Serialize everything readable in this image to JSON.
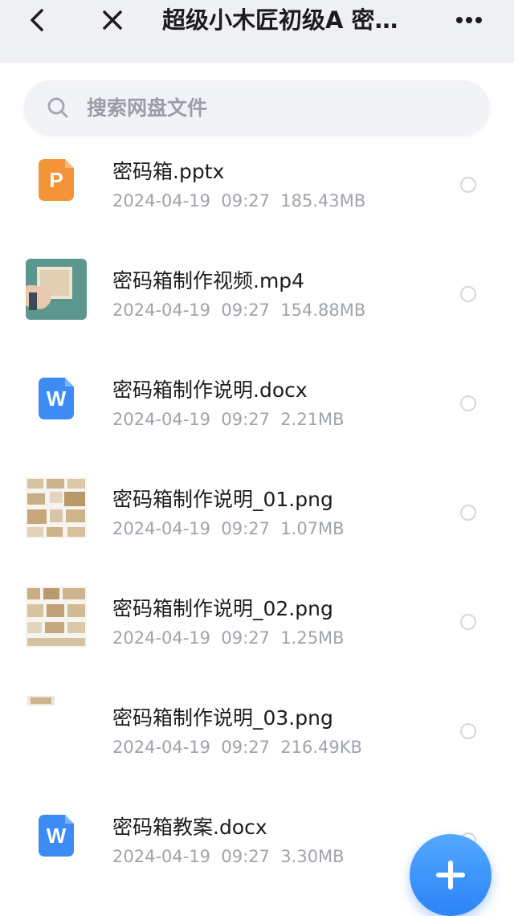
{
  "header": {
    "title": "超级小木匠初级A 密…",
    "back_icon": "chevron-left-icon",
    "close_icon": "close-icon",
    "more_icon": "more-horizontal-icon",
    "background": "#eef0f4"
  },
  "search": {
    "placeholder": "搜索网盘文件",
    "value": "",
    "icon": "search-icon"
  },
  "files": [
    {
      "name": "密码箱.pptx",
      "date": "2024-04-19",
      "time": "09:27",
      "size": "185.43MB",
      "type": "pptx",
      "icon": "ppt-file-icon",
      "color": "#f39438"
    },
    {
      "name": "密码箱制作视频.mp4",
      "date": "2024-04-19",
      "time": "09:27",
      "size": "154.88MB",
      "type": "mp4",
      "icon": "video-thumbnail"
    },
    {
      "name": "密码箱制作说明.docx",
      "date": "2024-04-19",
      "time": "09:27",
      "size": "2.21MB",
      "type": "docx",
      "icon": "word-file-icon",
      "color": "#3c8cf4"
    },
    {
      "name": "密码箱制作说明_01.png",
      "date": "2024-04-19",
      "time": "09:27",
      "size": "1.07MB",
      "type": "png",
      "icon": "image-thumbnail"
    },
    {
      "name": "密码箱制作说明_02.png",
      "date": "2024-04-19",
      "time": "09:27",
      "size": "1.25MB",
      "type": "png",
      "icon": "image-thumbnail"
    },
    {
      "name": "密码箱制作说明_03.png",
      "date": "2024-04-19",
      "time": "09:27",
      "size": "216.49KB",
      "type": "png",
      "icon": "image-thumbnail"
    },
    {
      "name": "密码箱教案.docx",
      "date": "2024-04-19",
      "time": "09:27",
      "size": "3.30MB",
      "type": "docx",
      "icon": "word-file-icon",
      "color": "#3c8cf4"
    }
  ],
  "fab": {
    "icon": "plus-icon",
    "color": "#2f8bf7"
  }
}
